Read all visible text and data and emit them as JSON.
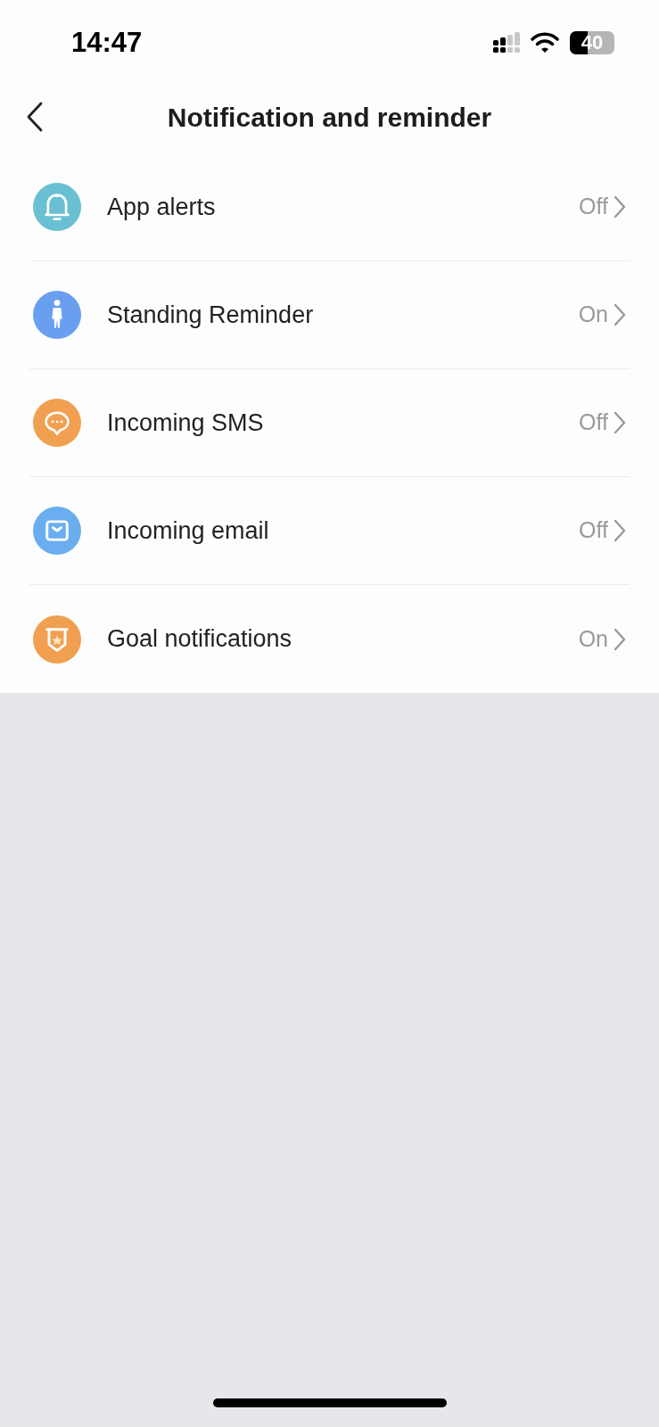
{
  "status_bar": {
    "time": "14:47",
    "battery": "40"
  },
  "header": {
    "title": "Notification and reminder"
  },
  "items": [
    {
      "kind": "bell",
      "color": "#6abfd2",
      "label": "App alerts",
      "value": "Off"
    },
    {
      "kind": "person",
      "color": "#6a9ff0",
      "label": "Standing Reminder",
      "value": "On"
    },
    {
      "kind": "chat",
      "color": "#f0a050",
      "label": "Incoming SMS",
      "value": "Off"
    },
    {
      "kind": "mail",
      "color": "#6aaef0",
      "label": "Incoming email",
      "value": "Off"
    },
    {
      "kind": "badge",
      "color": "#f0a050",
      "label": "Goal notifications",
      "value": "On"
    }
  ]
}
